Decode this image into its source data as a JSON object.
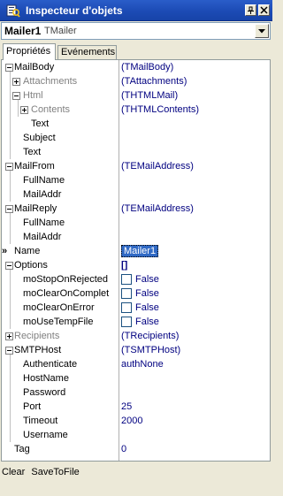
{
  "window": {
    "title": "Inspecteur d'objets"
  },
  "object_selector": {
    "name": "Mailer1",
    "class": "TMailer"
  },
  "tabs": [
    {
      "label": "Propriétés",
      "active": true
    },
    {
      "label": "Evénements",
      "active": false
    }
  ],
  "properties": [
    {
      "label": "MailBody",
      "value": "(TMailBody)"
    },
    {
      "label": "Attachments",
      "value": "(TAttachments)"
    },
    {
      "label": "Html",
      "value": "(THTMLMail)"
    },
    {
      "label": "Contents",
      "value": "(THTMLContents)"
    },
    {
      "label": "Text",
      "value": ""
    },
    {
      "label": "Subject",
      "value": ""
    },
    {
      "label": "Text",
      "value": ""
    },
    {
      "label": "MailFrom",
      "value": "(TEMailAddress)"
    },
    {
      "label": "FullName",
      "value": ""
    },
    {
      "label": "MailAddr",
      "value": ""
    },
    {
      "label": "MailReply",
      "value": "(TEMailAddress)"
    },
    {
      "label": "FullName",
      "value": ""
    },
    {
      "label": "MailAddr",
      "value": ""
    },
    {
      "label": "Name",
      "value": "Mailer1"
    },
    {
      "label": "Options",
      "value": "[]"
    },
    {
      "label": "moStopOnRejected",
      "value": "False"
    },
    {
      "label": "moClearOnComplet",
      "value": "False"
    },
    {
      "label": "moClearOnError",
      "value": "False"
    },
    {
      "label": "moUseTempFile",
      "value": "False"
    },
    {
      "label": "Recipients",
      "value": "(TRecipients)"
    },
    {
      "label": "SMTPHost",
      "value": "(TSMTPHost)"
    },
    {
      "label": "Authenticate",
      "value": "authNone"
    },
    {
      "label": "HostName",
      "value": ""
    },
    {
      "label": "Password",
      "value": ""
    },
    {
      "label": "Port",
      "value": "25"
    },
    {
      "label": "Timeout",
      "value": "2000"
    },
    {
      "label": "Username",
      "value": ""
    },
    {
      "label": "Tag",
      "value": "0"
    }
  ],
  "selected_marker": "»",
  "actions": [
    "Clear",
    "SaveToFile"
  ],
  "colors": {
    "title_bar": "#1c4bb5",
    "value_text": "#000080",
    "selection": "#316ac5",
    "inactive_text": "#808080"
  },
  "icons": {
    "title": "object-inspector-icon",
    "pin": "pin-icon",
    "close": "close-icon",
    "dropdown": "chevron-down-icon"
  }
}
